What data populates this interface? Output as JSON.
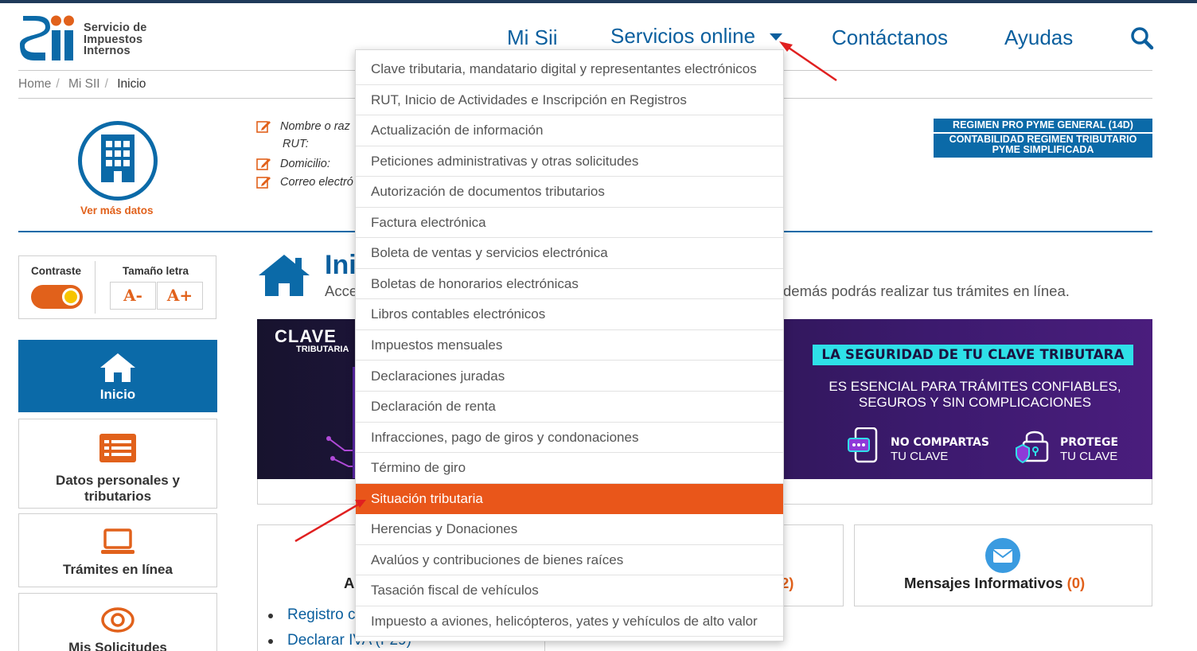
{
  "header": {
    "logo_word": "SII",
    "logo_lines": [
      "Servicio de",
      "Impuestos",
      "Internos"
    ],
    "nav": {
      "mi_sii": "Mi Sii",
      "servicios": "Servicios online",
      "contactanos": "Contáctanos",
      "ayudas": "Ayudas"
    }
  },
  "breadcrumb": {
    "home": "Home",
    "mi_sii": "Mi SII",
    "current": "Inicio",
    "separator": "/"
  },
  "profile": {
    "ver_mas": "Ver más datos",
    "fields": {
      "nombre": "Nombre o raz",
      "rut": "RUT:",
      "domicilio": "Domicilio:",
      "correo": "Correo electró"
    },
    "regimen": [
      "REGIMEN PRO PYME GENERAL (14D)",
      "CONTABILIDAD REGIMEN TRIBUTARIO",
      "PYME SIMPLIFICADA"
    ]
  },
  "accessibility": {
    "contraste": "Contraste",
    "contraste_on": true,
    "tamano": "Tamaño letra",
    "decrease": "A-",
    "increase": "A+"
  },
  "sidebar": {
    "items": [
      {
        "label": "Inicio",
        "icon": "home-icon",
        "active": true
      },
      {
        "label_1": "Datos personales y",
        "label_2": "tributarios",
        "icon": "list-card-icon"
      },
      {
        "label": "Trámites en línea",
        "icon": "laptop-icon"
      },
      {
        "label": "Mis Solicitudes",
        "icon": "eye-icon"
      }
    ]
  },
  "main": {
    "title": "Ini",
    "desc_left": "Acce",
    "desc_right": "demás podrás realizar tus trámites en línea.",
    "banner": {
      "brand_1": "CLAVE",
      "brand_2": "TRIBUTARIA",
      "headline": "LA SEGURIDAD DE TU CLAVE TRIBUTARA",
      "sub_1": "ES ESENCIAL PARA TRÁMITES CONFIABLES,",
      "sub_2": "SEGUROS Y SIN COMPLICACIONES",
      "tag1_a": "NO COMPARTAS",
      "tag1_b": "TU CLAVE",
      "tag2_a": "PROTEGE",
      "tag2_b": "TU CLAVE"
    },
    "cards": {
      "left_title": "A",
      "mid_suffix": "2)",
      "mensajes_title": "Mensajes Informativos",
      "mensajes_count": "(0)"
    },
    "links": {
      "registro": "Registro c",
      "declarar": "Declarar IVA (F29)"
    }
  },
  "dropdown": {
    "items": [
      "Clave tributaria, mandatario digital y representantes electrónicos",
      "RUT, Inicio de Actividades e Inscripción en Registros",
      "Actualización de información",
      "Peticiones administrativas y otras solicitudes",
      "Autorización de documentos tributarios",
      "Factura electrónica",
      "Boleta de ventas y servicios electrónica",
      "Boletas de honorarios electrónicas",
      "Libros contables electrónicos",
      "Impuestos mensuales",
      "Declaraciones juradas",
      "Declaración de renta",
      "Infracciones, pago de giros y condonaciones",
      "Término de giro",
      "Situación tributaria",
      "Herencias y Donaciones",
      "Avalúos y contribuciones de bienes raíces",
      "Tasación fiscal de vehículos",
      "Impuesto a aviones, helicópteros, yates y vehículos de alto valor"
    ],
    "highlighted_index": 14
  },
  "colors": {
    "brand_blue": "#0b5f9e",
    "accent_orange": "#e9561a",
    "annotation_red": "#e02020"
  }
}
